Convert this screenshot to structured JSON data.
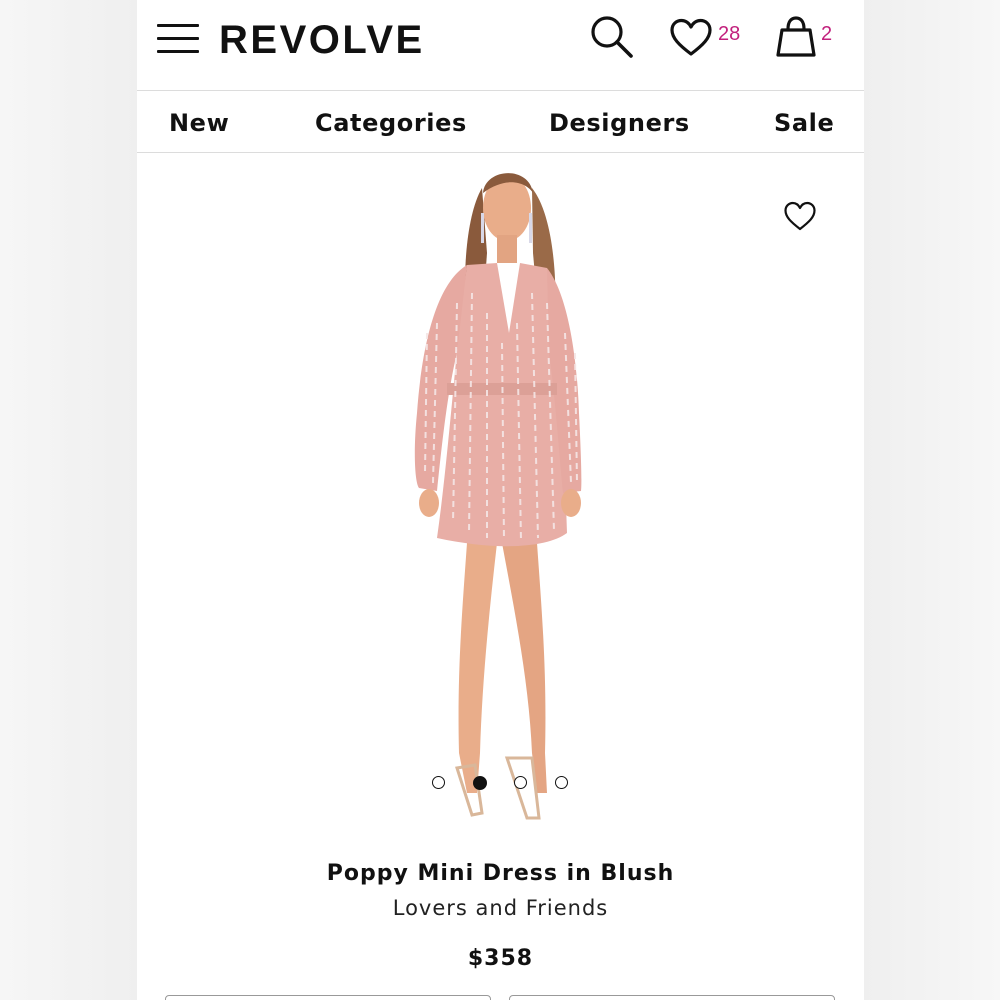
{
  "header": {
    "logo": "REVOLVE",
    "favorites_count": "28",
    "bag_count": "2"
  },
  "nav": {
    "items": [
      "New",
      "Categories",
      "Designers",
      "Sale"
    ]
  },
  "gallery": {
    "image_count": 4,
    "active_index": 1
  },
  "product": {
    "name": "Poppy Mini Dress in Blush",
    "designer": "Lovers and Friends",
    "price": "$358"
  },
  "colors": {
    "accent": "#c2217d",
    "dress": "#e8aea6",
    "skin": "#e9ad8a",
    "hair": "#8a5a3c"
  },
  "icons": [
    "menu-icon",
    "search-icon",
    "heart-icon",
    "bag-icon",
    "wishlist-heart-icon"
  ]
}
